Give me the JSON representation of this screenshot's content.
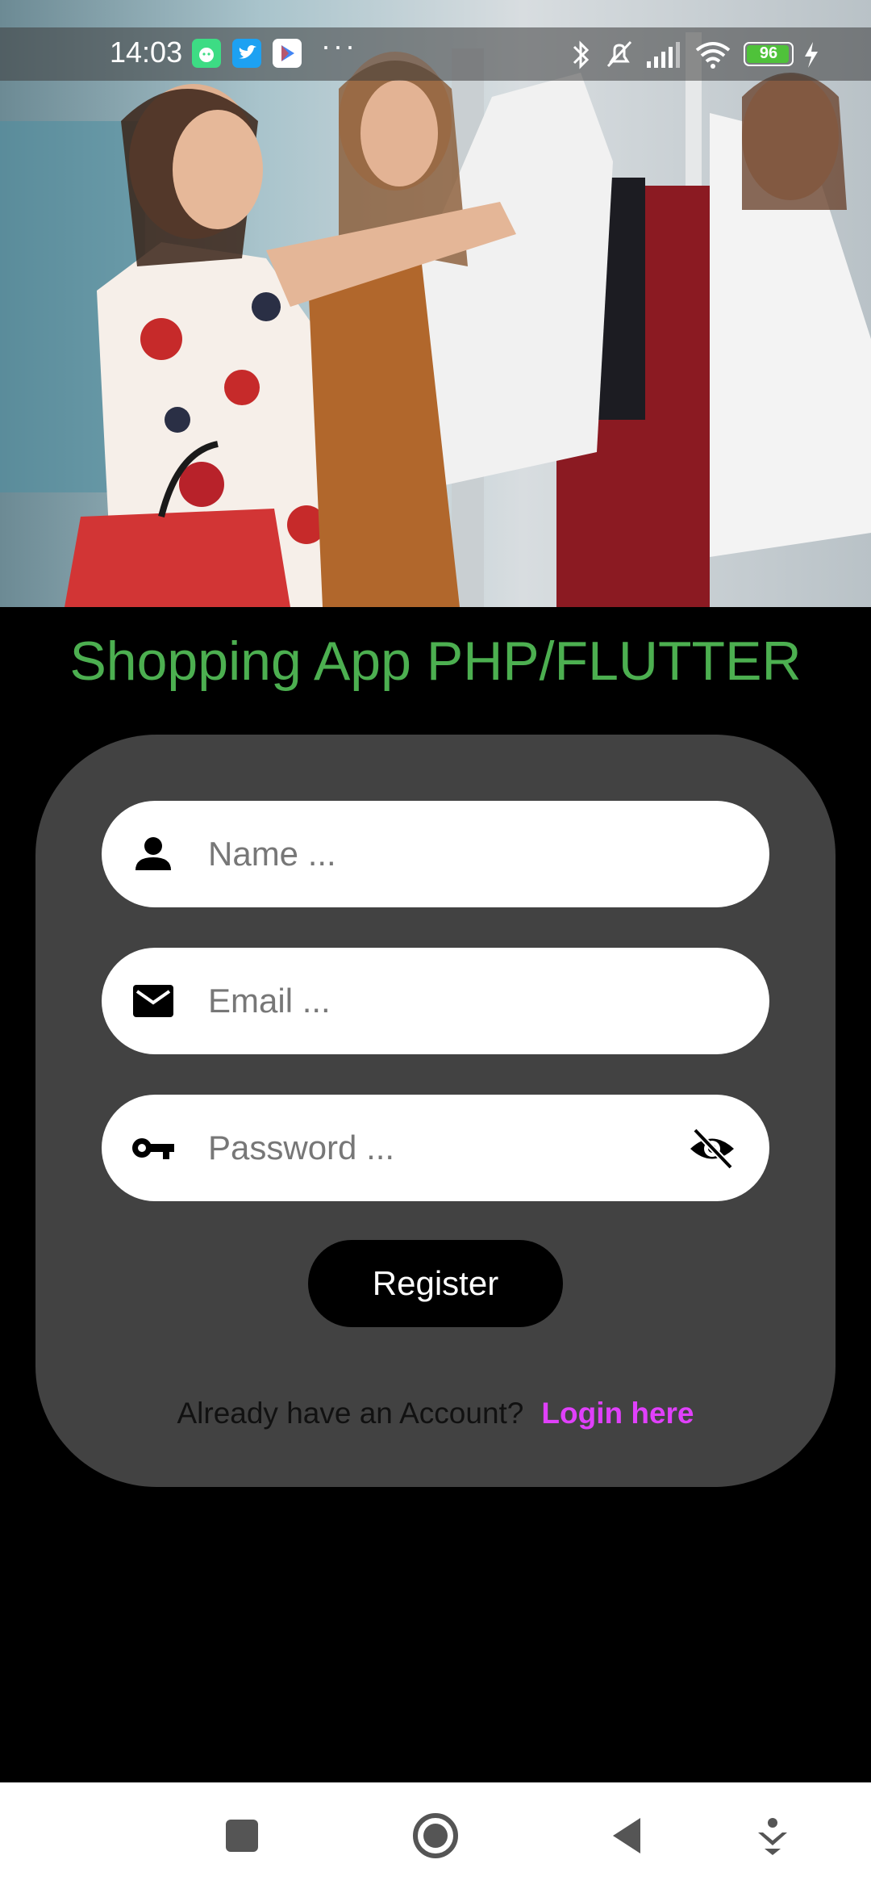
{
  "status_bar": {
    "time": "14:03",
    "more_indicator": "···",
    "battery_level": "96",
    "battery_fraction": 0.96,
    "notification_icons": [
      "android-icon",
      "twitter-icon",
      "play-store-icon"
    ],
    "system_icons": [
      "bluetooth-icon",
      "silent-bell-icon",
      "signal-icon",
      "wifi-icon",
      "battery-icon",
      "charging-icon"
    ]
  },
  "hero": {
    "description_icon": "shopping-photo"
  },
  "app_title": "Shopping App PHP/FLUTTER",
  "form": {
    "name": {
      "placeholder": "Name ...",
      "value": "",
      "icon": "person-icon"
    },
    "email": {
      "placeholder": "Email ...",
      "value": "",
      "icon": "mail-icon"
    },
    "password": {
      "placeholder": "Password ...",
      "value": "",
      "icon": "key-icon",
      "toggle_icon": "eye-off-icon"
    },
    "register_label": "Register",
    "login_prompt": "Already have an Account?",
    "login_link": "Login here"
  },
  "colors": {
    "title": "#4CAF50",
    "card": "#424242",
    "link": "#e040fb",
    "button": "#000000"
  },
  "nav_bar": {
    "buttons": [
      "square-recents-icon",
      "circle-home-icon",
      "triangle-back-icon",
      "download-hide-icon"
    ]
  }
}
